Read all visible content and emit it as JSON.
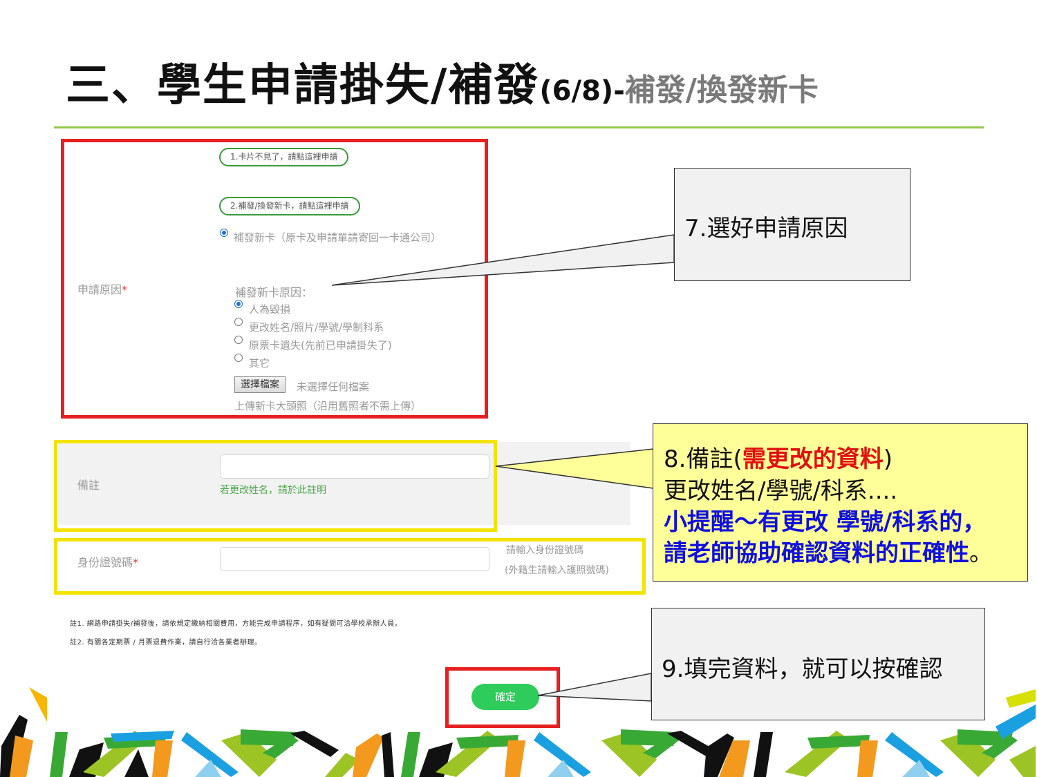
{
  "slide": {
    "title_main": "三、學生申請掛失/補發",
    "title_page": "(6/8)-",
    "title_sub": "補發/換發新卡"
  },
  "form": {
    "option_lost_button": "1.卡片不見了，請點這裡申請",
    "option_reissue_button": "2.補發/換發新卡，請點這裡申請",
    "reissue_radio_label": "補發新卡（原卡及申請單請寄回一卡通公司）",
    "reason_label": "申請原因",
    "required_mark": "*",
    "reason_heading": "補發新卡原因：",
    "reasons": [
      {
        "label": "人為毀損",
        "selected": true
      },
      {
        "label": "更改姓名/照片/學號/學制科系",
        "selected": false
      },
      {
        "label": "原票卡遺失(先前已申請掛失了)",
        "selected": false
      },
      {
        "label": "其它",
        "selected": false
      }
    ],
    "file_button": "選擇檔案",
    "file_status": "未選擇任何檔案",
    "photo_hint": "上傳新卡大頭照（沿用舊照者不需上傳）",
    "remark_label": "備註",
    "remark_value": "",
    "remark_hint": "若更改姓名，請於此註明",
    "id_label": "身份證號碼",
    "id_value": "",
    "id_hint_1": "請輸入身份證號碼",
    "id_hint_2": "(外籍生請輸入護照號碼)",
    "note_1": "註1. 網路申請掛失/補發後，請依規定繳納相關費用，方能完成申請程序，如有疑問可洽學校承辦人員。",
    "note_2": "註2. 有關各定期票 / 月票退費作業，請自行洽各業者辦理。",
    "confirm_button": "確定"
  },
  "callouts": {
    "step7": "7.選好申請原因",
    "step8_prefix": "8.備註(",
    "step8_red": "需更改的資料",
    "step8_suffix": ")",
    "step8_line2": "更改姓名/學號/科系....",
    "step8_line3": "小提醒～有更改 學號/科系的，",
    "step8_line4": "請老師協助確認資料的正確性",
    "step8_line4_end": "。",
    "step9": "9.填完資料，就可以按確認"
  },
  "colors": {
    "title_rule": "#92c94a",
    "highlight_red": "#e62020",
    "highlight_yellow": "#f3e300",
    "button_green": "#2ecc5a",
    "callout_text_red": "#e01010",
    "callout_text_blue": "#1010dd"
  }
}
